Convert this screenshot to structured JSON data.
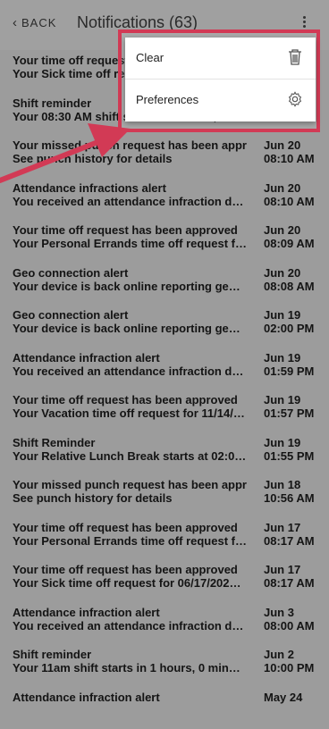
{
  "header": {
    "back_label": "BACK",
    "title": "Notifications (63)"
  },
  "menu": {
    "items": [
      {
        "label": "Clear",
        "icon": "trash-icon"
      },
      {
        "label": "Preferences",
        "icon": "gear-icon"
      }
    ]
  },
  "notifications": [
    {
      "title": "Your time off request has been approved",
      "body": "Your Sick time off request for 06/17/2025 ...",
      "date": "",
      "time": ""
    },
    {
      "title": "Shift reminder",
      "body": "Your 08:30 AM shift starts in 1 hours, 0 m...",
      "date": "",
      "time": ""
    },
    {
      "title": "Your missed punch request has been appr...",
      "body": "See punch history for details",
      "date": "Jun 20",
      "time": "08:10 AM"
    },
    {
      "title": "Attendance infractions alert",
      "body": "You received an attendance infraction due ...",
      "date": "Jun 20",
      "time": "08:10 AM"
    },
    {
      "title": "Your time off request has been approved",
      "body": "Your Personal Errands time off request for ...",
      "date": "Jun 20",
      "time": "08:09 AM"
    },
    {
      "title": "Geo connection alert",
      "body": "Your device is back online reporting geo lo...",
      "date": "Jun 20",
      "time": "08:08 AM"
    },
    {
      "title": "Geo connection alert",
      "body": "Your device is back online reporting geo lo...",
      "date": "Jun 19",
      "time": "02:00 PM"
    },
    {
      "title": "Attendance infraction alert",
      "body": "You received an attendance infraction due ...",
      "date": "Jun 19",
      "time": "01:59 PM"
    },
    {
      "title": "Your time off request has been approved",
      "body": "Your Vacation time off request for 11/14/2...",
      "date": "Jun 19",
      "time": "01:57 PM"
    },
    {
      "title": "Shift Reminder",
      "body": "Your Relative Lunch Break starts at 02:00 ...",
      "date": "Jun 19",
      "time": "01:55 PM"
    },
    {
      "title": "Your missed punch request has been appr...",
      "body": "See punch history for details",
      "date": "Jun 18",
      "time": "10:56 AM"
    },
    {
      "title": "Your time off request has been approved",
      "body": "Your Personal Errands time off request for ...",
      "date": "Jun 17",
      "time": "08:17 AM"
    },
    {
      "title": "Your time off request has been approved",
      "body": "Your Sick time off request for 06/17/2025 ...",
      "date": "Jun 17",
      "time": "08:17 AM"
    },
    {
      "title": "Attendance infraction alert",
      "body": "You received an attendance infraction due ...",
      "date": "Jun 3",
      "time": "08:00 AM"
    },
    {
      "title": "Shift reminder",
      "body": "Your 11am shift starts in 1 hours, 0 minute...",
      "date": "Jun 2",
      "time": "10:00 PM"
    },
    {
      "title": "Attendance infraction alert",
      "body": "",
      "date": "May 24",
      "time": ""
    }
  ]
}
